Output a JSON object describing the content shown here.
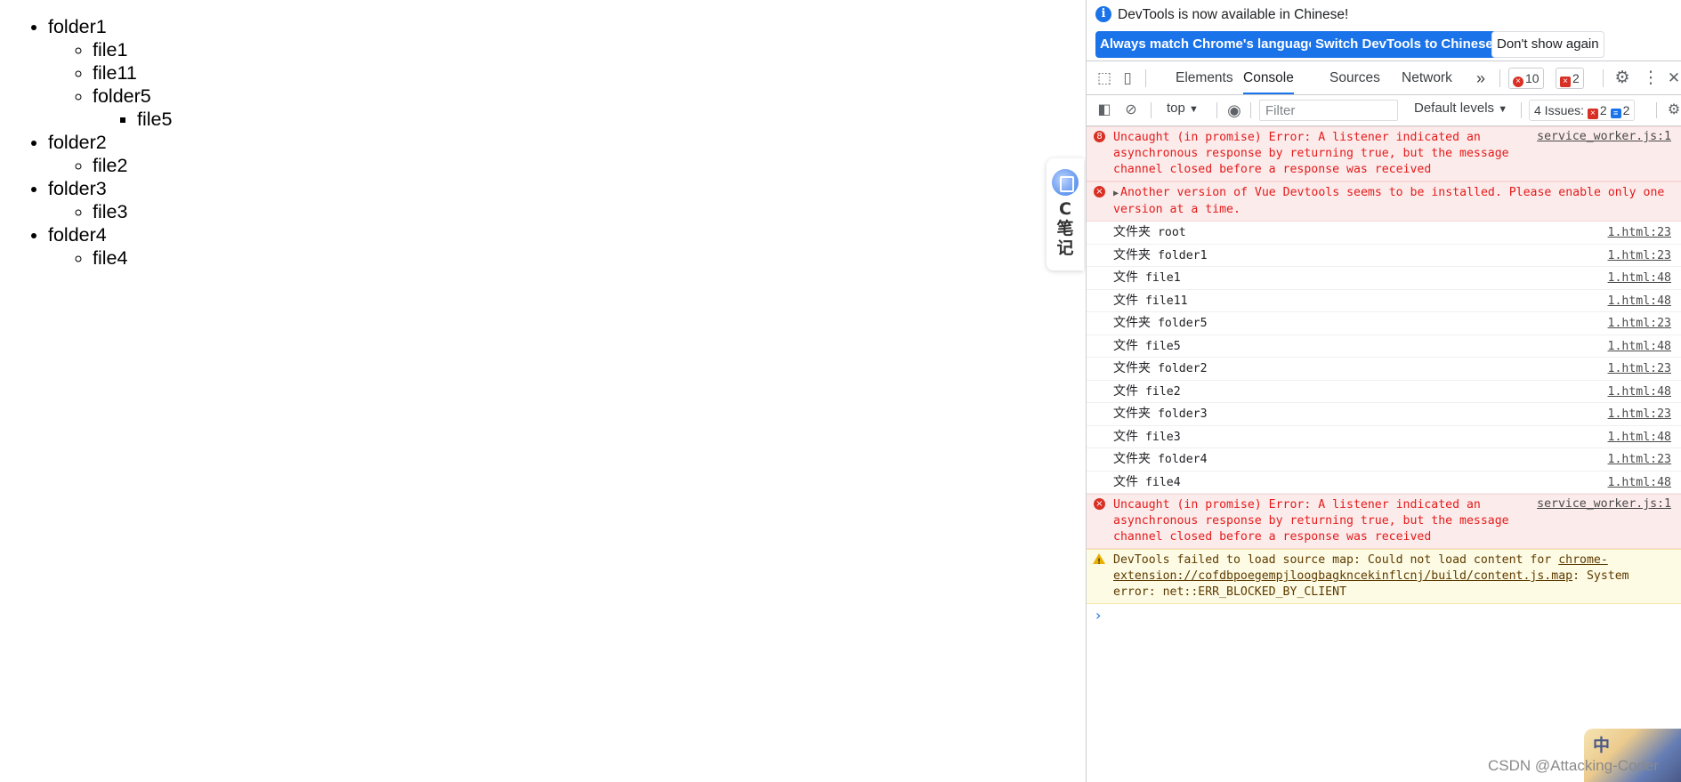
{
  "tree": {
    "folders": [
      {
        "name": "folder1",
        "files": [
          "file1",
          "file11"
        ],
        "sub": {
          "name": "folder5",
          "files": [
            "file5"
          ]
        }
      },
      {
        "name": "folder2",
        "files": [
          "file2"
        ]
      },
      {
        "name": "folder3",
        "files": [
          "file3"
        ]
      },
      {
        "name": "folder4",
        "files": [
          "file4"
        ]
      }
    ]
  },
  "widget": {
    "line1": "C",
    "line2": "笔",
    "line3": "记"
  },
  "infobar": {
    "message": "DevTools is now available in Chinese!",
    "btn_match": "Always match Chrome's language",
    "btn_switch": "Switch DevTools to Chinese",
    "btn_dismiss": "Don't show again"
  },
  "tabs": {
    "elements": "Elements",
    "console": "Console",
    "sources": "Sources",
    "network": "Network",
    "more": "»",
    "errors_count": "10",
    "issues_count": "2"
  },
  "filterbar": {
    "context": "top",
    "filter_placeholder": "Filter",
    "levels": "Default levels",
    "issues_label": "4 Issues:",
    "issues_err": "2",
    "issues_info": "2"
  },
  "console": {
    "msg1": {
      "count": "8",
      "text": "Uncaught (in promise) Error: A listener indicated an asynchronous response by returning true, but the message channel closed before a response was received",
      "src": "service_worker.js:1"
    },
    "msg2": {
      "text": "Another version of Vue Devtools seems to be installed. Please enable only one version at a time."
    },
    "logs": [
      {
        "label": "文件夹",
        "name": "root",
        "src": "1.html:23"
      },
      {
        "label": "文件夹",
        "name": "folder1",
        "src": "1.html:23"
      },
      {
        "label": "文件",
        "name": "file1",
        "src": "1.html:48"
      },
      {
        "label": "文件",
        "name": "file11",
        "src": "1.html:48"
      },
      {
        "label": "文件夹",
        "name": "folder5",
        "src": "1.html:23"
      },
      {
        "label": "文件",
        "name": "file5",
        "src": "1.html:48"
      },
      {
        "label": "文件夹",
        "name": "folder2",
        "src": "1.html:23"
      },
      {
        "label": "文件",
        "name": "file2",
        "src": "1.html:48"
      },
      {
        "label": "文件夹",
        "name": "folder3",
        "src": "1.html:23"
      },
      {
        "label": "文件",
        "name": "file3",
        "src": "1.html:48"
      },
      {
        "label": "文件夹",
        "name": "folder4",
        "src": "1.html:23"
      },
      {
        "label": "文件",
        "name": "file4",
        "src": "1.html:48"
      }
    ],
    "msg3": {
      "text": "Uncaught (in promise) Error: A listener indicated an asynchronous response by returning true, but the message channel closed before a response was received",
      "src": "service_worker.js:1"
    },
    "warn": {
      "prefix": "DevTools failed to load source map: Could not load content for ",
      "link": "chrome-extension://cofdbpoegempjloogbagkncekinflcnj/build/content.js.map",
      "suffix": ": System error: net::ERR_BLOCKED_BY_CLIENT"
    },
    "prompt": "›"
  },
  "watermark": "CSDN @Attacking-Coder",
  "avatar_text": "中"
}
